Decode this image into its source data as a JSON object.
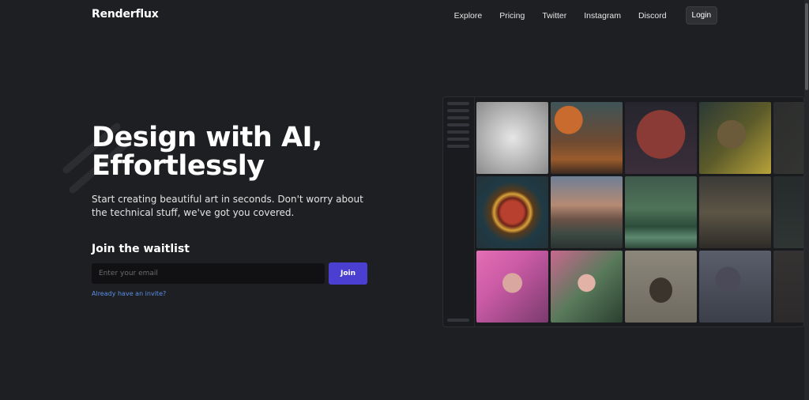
{
  "brand": {
    "name": "Renderflux"
  },
  "nav": {
    "links": [
      "Explore",
      "Pricing",
      "Twitter",
      "Instagram",
      "Discord"
    ],
    "login_label": "Login"
  },
  "hero": {
    "title_line1": "Design with AI,",
    "title_line2": "Effortlessly",
    "subtitle": "Start creating beautiful art in seconds. Don't worry about the technical stuff, we've got you covered."
  },
  "waitlist": {
    "label": "Join the waitlist",
    "email_placeholder": "Enter your email",
    "email_value": "",
    "join_label": "Join",
    "invite_link": "Already have an invite?"
  },
  "colors": {
    "background": "#1e1f22",
    "accent": "#4a3fd1",
    "link": "#5b8fe8"
  },
  "gallery": {
    "tiles": [
      {
        "name": "gallery-image-gray-cat",
        "bg": "radial-gradient(circle at 50% 50%, #e6e6e6 0%, #bdbdbd 45%, #8a8a8a 100%)"
      },
      {
        "name": "gallery-image-red-moon-spires",
        "bg": "radial-gradient(circle at 25% 25%, #c96a2e 0 18%, transparent 19%), linear-gradient(180deg, #3f5458 0%, #6e4a32 55%, #9a5b2d 80%, #3b2a20 100%)"
      },
      {
        "name": "gallery-image-red-planet",
        "bg": "radial-gradient(circle at 50% 45%, #8a3b36 0 45%, transparent 46%), linear-gradient(180deg, #26252e 0%, #3a2e3a 100%)"
      },
      {
        "name": "gallery-image-cyber-woman",
        "bg": "radial-gradient(circle at 45% 45%, #6b5b3a 0 25%, transparent 26%), linear-gradient(135deg, #2c3a36 0%, #5b5a2a 50%, #b8a23a 100%)"
      },
      {
        "name": "gallery-image-partial-scene-1",
        "bg": "linear-gradient(135deg, #3a3c38 0%, #4e4f46 100%)",
        "dim": true
      },
      {
        "name": "gallery-image-glowing-ring",
        "bg": "radial-gradient(circle at 50% 50%, #b8402f 0 22%, #6a2418 28%, #d7a23a 36%, #5a3a1a 42%, #1f3a44 60%, #243238 100%)"
      },
      {
        "name": "gallery-image-sunset-mountains",
        "bg": "linear-gradient(180deg, #6f7f96 0%, #b58a73 40%, #6b5247 60%, #3d4a44 80%, #2b3330 100%)"
      },
      {
        "name": "gallery-image-green-forest-lake",
        "bg": "linear-gradient(180deg, #3f5a4c 0%, #4f7358 45%, #2c4c3a 70%, #5e8a70 85%, #2f4a3a 100%)"
      },
      {
        "name": "gallery-image-ruined-castle",
        "bg": "linear-gradient(180deg, #3b3a36 0%, #5c5546 50%, #2f2c28 100%)"
      },
      {
        "name": "gallery-image-partial-scene-2",
        "bg": "linear-gradient(180deg, #2f3836 0%, #3e4a44 100%)",
        "dim": true
      },
      {
        "name": "gallery-image-pink-hair-woman",
        "bg": "radial-gradient(circle at 50% 45%, #d9a6a0 0 18%, transparent 19%), linear-gradient(135deg, #e46fb4 0%, #c95aa4 40%, #7a3b6e 100%)"
      },
      {
        "name": "gallery-image-fantasy-girl",
        "bg": "radial-gradient(circle at 50% 45%, #e2b2a6 0 16%, transparent 17%), linear-gradient(135deg, #c9688e 0%, #5a7a5c 50%, #2a4030 100%)"
      },
      {
        "name": "gallery-image-armored-warrior",
        "bg": "radial-gradient(ellipse at 50% 55%, #3a342c 0 22%, transparent 23%), linear-gradient(180deg, #8c877b 0%, #6e6a60 100%)"
      },
      {
        "name": "gallery-image-misty-tree",
        "bg": "radial-gradient(circle at 40% 40%, #4a4a58 0 20%, transparent 21%), linear-gradient(180deg, #5a5e6a 0%, #3c3f4a 100%)"
      },
      {
        "name": "gallery-image-partial-scene-3",
        "bg": "linear-gradient(180deg, #4a4642 0%, #3a3634 100%)",
        "dim": true
      }
    ]
  }
}
